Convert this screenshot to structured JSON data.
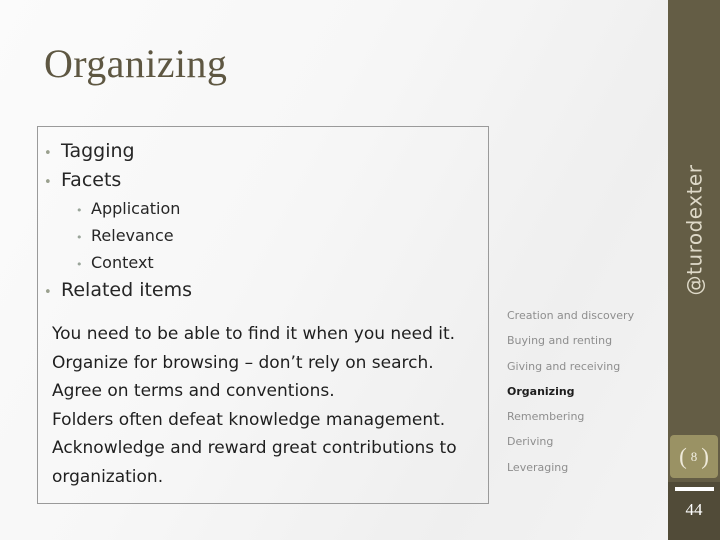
{
  "slide": {
    "title": "Organizing",
    "accent_color": "#645d45",
    "badge_color": "#9a9264",
    "body_text_color": "#1f1f1f"
  },
  "bullets": [
    {
      "level": 1,
      "marker": "•",
      "label": "Tagging"
    },
    {
      "level": 1,
      "marker": "•",
      "label": "Facets"
    },
    {
      "level": 2,
      "marker": "•",
      "label": "Application"
    },
    {
      "level": 2,
      "marker": "•",
      "label": "Relevance"
    },
    {
      "level": 2,
      "marker": "•",
      "label": "Context"
    },
    {
      "level": 1,
      "marker": "•",
      "label": "Related items"
    }
  ],
  "body_lines": [
    "You need to be able to find it when you need it.",
    "Organize for browsing – don’t rely on search.",
    "Agree on terms and conventions.",
    "Folders often defeat knowledge management.",
    "Acknowledge and reward great contributions to organization."
  ],
  "nav": {
    "items": [
      {
        "label": "Creation and discovery",
        "active": false
      },
      {
        "label": "Buying and renting",
        "active": false
      },
      {
        "label": "Giving and receiving",
        "active": false
      },
      {
        "label": "Organizing",
        "active": true
      },
      {
        "label": "Remembering",
        "active": false
      },
      {
        "label": "Deriving",
        "active": false
      },
      {
        "label": "Leveraging",
        "active": false
      }
    ]
  },
  "sidebar": {
    "handle": "@turodexter",
    "badge_open_bracket": "(",
    "badge_number": "8",
    "badge_close_bracket": ")",
    "slide_number": "44"
  }
}
